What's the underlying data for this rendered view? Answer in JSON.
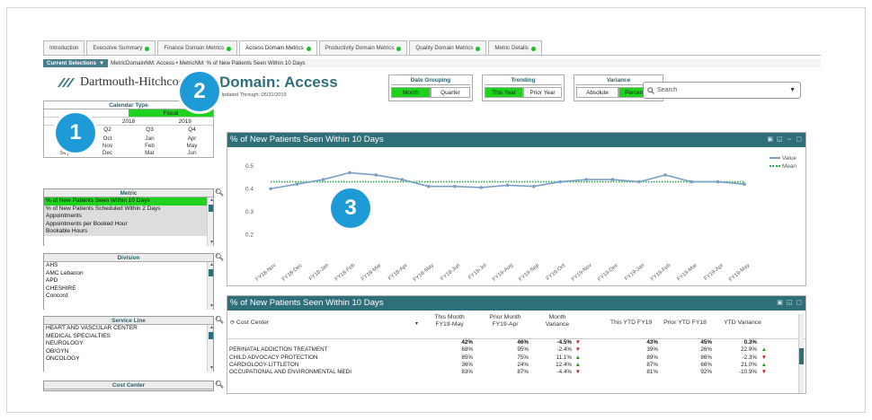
{
  "tabs": [
    {
      "label": "Introduction",
      "dot": false,
      "active": false
    },
    {
      "label": "Executive Summary",
      "dot": true,
      "active": false
    },
    {
      "label": "Finance Domain Metrics",
      "dot": true,
      "active": false
    },
    {
      "label": "Access Domain Metrics",
      "dot": true,
      "active": true
    },
    {
      "label": "Productivity Domain Metrics",
      "dot": true,
      "active": false
    },
    {
      "label": "Quality Domain Metrics",
      "dot": true,
      "active": false
    },
    {
      "label": "Metric Details",
      "dot": true,
      "active": false
    }
  ],
  "selections": {
    "label": "Current Selections",
    "value": "MetricDomainNM: Access • MetricNM: % of New Patients Seen Within 10 Days"
  },
  "logo_text": "Dartmouth-Hitchcock",
  "page": {
    "title": "Domain: Access",
    "updated": "Updated Through: 05/31/2019"
  },
  "toggles": [
    {
      "title": "Date Grouping",
      "options": [
        "Month",
        "Quarter"
      ],
      "selected": 0
    },
    {
      "title": "Trending",
      "options": [
        "This Year",
        "Prior Year"
      ],
      "selected": 0
    },
    {
      "title": "Variance",
      "options": [
        "Absolute",
        "Percentage"
      ],
      "selected": 1
    }
  ],
  "search": {
    "placeholder": "Search"
  },
  "calendar": {
    "title": "Calendar Type",
    "types": [
      "",
      "Fiscal"
    ],
    "years": [
      "",
      "2018",
      "2019"
    ],
    "quarters": [
      "",
      "Q2",
      "Q3",
      "Q4"
    ],
    "months": [
      "Jul",
      "Oct",
      "Jan",
      "Apr",
      "Aug",
      "Nov",
      "Feb",
      "May",
      "Sep",
      "Dec",
      "Mar",
      "Jun"
    ]
  },
  "metric_panel": {
    "title": "Metric",
    "items": [
      "% of New Patients Seen Within 10 Days",
      "% of New Patients Scheduled Within 2 Days",
      "Appointments",
      "Appointments per Booked Hour",
      "Bookable Hours"
    ]
  },
  "division_panel": {
    "title": "Division",
    "items": [
      "AHS",
      "AMC Lebanon",
      "APD",
      "CHESHIRE",
      "Concord"
    ]
  },
  "service_panel": {
    "title": "Service Line",
    "items": [
      "HEART AND VASCULAR CENTER",
      "MEDICAL SPECIALTIES",
      "NEUROLOGY",
      "OB/GYN",
      "ONCOLOGY"
    ]
  },
  "cost_panel": {
    "title": "Cost Center"
  },
  "badges": [
    "1",
    "2",
    "3"
  ],
  "chart_panel_title": "% of New Patients Seen Within 10 Days",
  "chart_data": {
    "type": "line",
    "title": "% of New Patients Seen Within 10 Days",
    "x": [
      "FY18-Nov",
      "FY18-Dec",
      "FY18-Jan",
      "FY18-Feb",
      "FY18-Mar",
      "FY18-Apr",
      "FY18-May",
      "FY18-Jun",
      "FY19-Jul",
      "FY19-Aug",
      "FY19-Sep",
      "FY19-Oct",
      "FY19-Nov",
      "FY19-Dec",
      "FY19-Jan",
      "FY19-Feb",
      "FY19-Mar",
      "FY19-Apr",
      "FY19-May"
    ],
    "series": [
      {
        "name": "Value",
        "values": [
          0.4,
          0.42,
          0.44,
          0.47,
          0.46,
          0.44,
          0.41,
          0.41,
          0.405,
          0.415,
          0.41,
          0.43,
          0.44,
          0.44,
          0.43,
          0.46,
          0.43,
          0.43,
          0.42
        ]
      },
      {
        "name": "Mean",
        "values": [
          0.43,
          0.43,
          0.43,
          0.43,
          0.43,
          0.43,
          0.43,
          0.43,
          0.43,
          0.43,
          0.43,
          0.43,
          0.43,
          0.43,
          0.43,
          0.43,
          0.43,
          0.43,
          0.43
        ]
      }
    ],
    "yticks": [
      "0.5",
      "0.4",
      "0.3",
      "0.2"
    ],
    "ylim": [
      0.15,
      0.55
    ],
    "legend": "top-right",
    "colors": {
      "value": "#7a9fc7",
      "mean": "#2aa84a"
    }
  },
  "table_panel_title": "% of New Patients Seen Within 10 Days",
  "table": {
    "headers": {
      "cost_center": "Cost Center",
      "this_month": "This Month FY19-May",
      "prior_month": "Prior Month FY19-Apr",
      "month_var": "Month Variance",
      "this_ytd": "This YTD FY19",
      "prior_ytd": "Prior YTD FY18",
      "ytd_var": "YTD Variance"
    },
    "rows": [
      {
        "cc": "",
        "tm": "42%",
        "pm": "46%",
        "mv": "-4.5%",
        "mvd": "down",
        "ty": "43%",
        "py": "45%",
        "yv": "0.3%",
        "yvd": ""
      },
      {
        "cc": "PERINATAL ADDICTION TREATMENT",
        "tm": "68%",
        "pm": "95%",
        "mv": "-2.4%",
        "mvd": "down",
        "ty": "39%",
        "py": "26%",
        "yv": "22.9%",
        "yvd": "up"
      },
      {
        "cc": "CHILD ADVOCACY PROTECTION",
        "tm": "85%",
        "pm": "75%",
        "mv": "11.1%",
        "mvd": "up",
        "ty": "89%",
        "py": "86%",
        "yv": "-2.3%",
        "yvd": "down"
      },
      {
        "cc": "CARDIOLOGY-LITTLETON",
        "tm": "36%",
        "pm": "24%",
        "mv": "12.4%",
        "mvd": "up",
        "ty": "87%",
        "py": "66%",
        "yv": "21.0%",
        "yvd": "up"
      },
      {
        "cc": "OCCUPATIONAL AND ENVIRONMENTAL MEDI",
        "tm": "83%",
        "pm": "87%",
        "mv": "-4.4%",
        "mvd": "down",
        "ty": "81%",
        "py": "92%",
        "yv": "-10.9%",
        "yvd": "down"
      }
    ]
  }
}
